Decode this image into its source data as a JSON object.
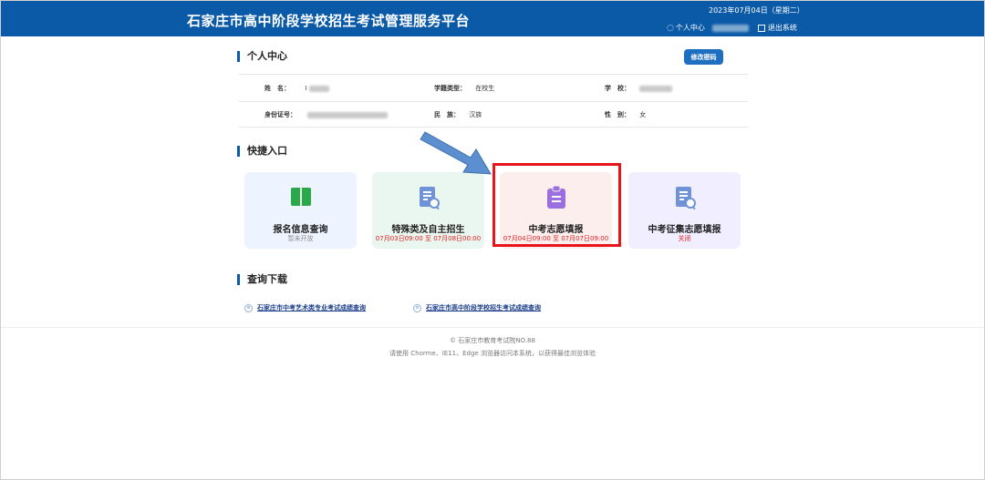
{
  "header": {
    "title": "石家庄市高中阶段学校招生考试管理服务平台",
    "date": "2023年07月04日（星期二）",
    "user_center": "个人中心",
    "logout": "退出系统"
  },
  "personal": {
    "section_title": "个人中心",
    "change_password": "修改密码",
    "name_label": "姓　名：",
    "name_value": "I",
    "status_label": "学籍类型：",
    "status_value": "在校生",
    "school_label": "学　校：",
    "id_label": "身份证号：",
    "ethnic_label": "民　族：",
    "ethnic_value": "汉族",
    "gender_label": "性　别：",
    "gender_value": "女"
  },
  "quick": {
    "section_title": "快捷入口",
    "cards": [
      {
        "name": "报名信息查询",
        "sub": "暂未开放"
      },
      {
        "name": "特殊类及自主招生",
        "sub": "07月03日09:00 至 07月08日00:00"
      },
      {
        "name": "中考志愿填报",
        "sub": "07月04日09:00 至 07月07日09:00"
      },
      {
        "name": "中考征集志愿填报",
        "sub": "关闭"
      }
    ]
  },
  "downloads": {
    "section_title": "查询下载",
    "links": [
      "石家庄市中考艺术类专业考试成绩查询",
      "石家庄市高中阶段学校招生考试成绩查询"
    ]
  },
  "footer": {
    "copyright": "© 石家庄市教育考试院NO.88",
    "browser_note": "请使用 Chorme、IE11、Edge 浏览器访问本系统，以获得最佳浏览体验"
  },
  "colors": {
    "header_bg": "#0b5aa8",
    "highlight_border": "#e8141a",
    "arrow": "#5b8fd0"
  }
}
